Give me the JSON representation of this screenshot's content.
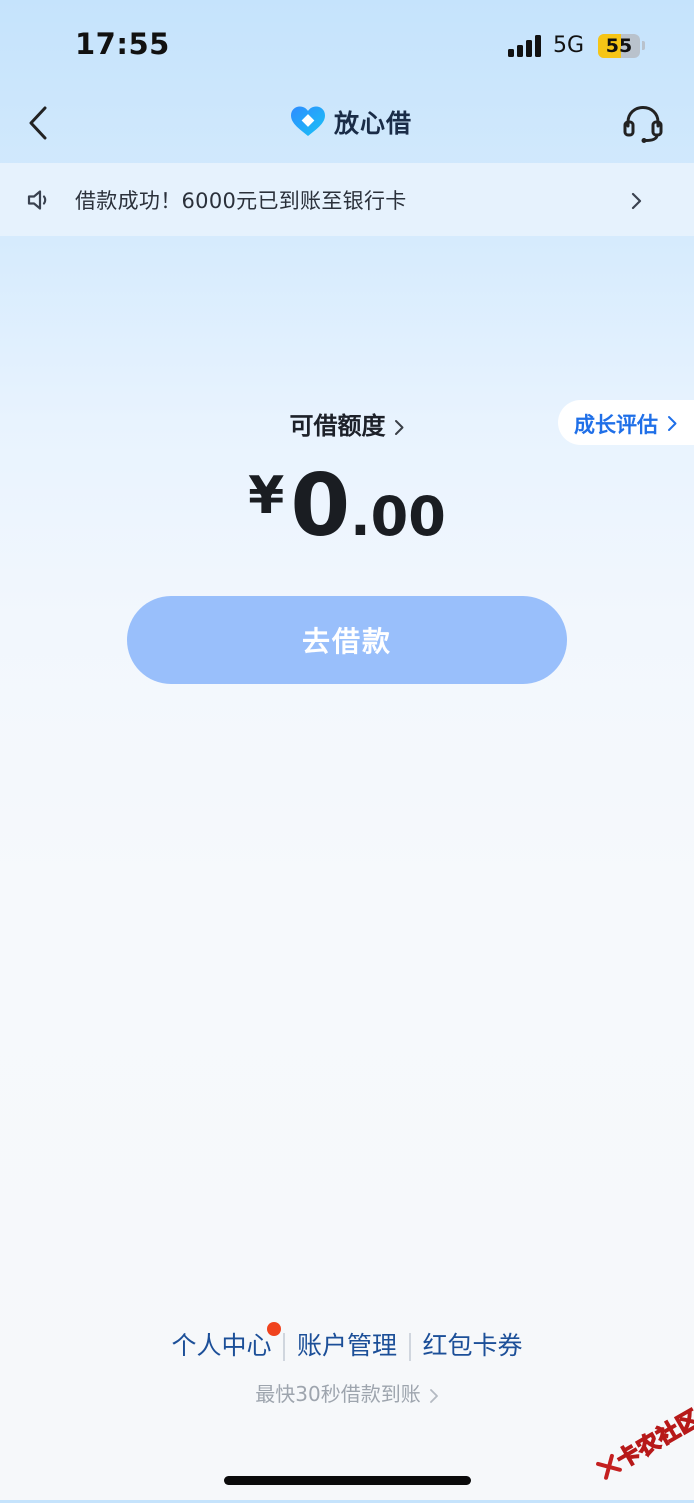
{
  "status_bar": {
    "time": "17:55",
    "network": "5G",
    "battery_level": "55",
    "battery_fraction": 0.55
  },
  "nav": {
    "title": "放心借",
    "back_icon": "chevron-left-icon",
    "support_icon": "headset-icon"
  },
  "notice": {
    "icon": "speaker-icon",
    "text": "借款成功！6000元已到账至银行卡"
  },
  "credit": {
    "label": "可借额度",
    "currency": "¥",
    "amount_int": "0",
    "amount_dec": ".00",
    "growth_label": "成长评估"
  },
  "actions": {
    "borrow_label": "去借款"
  },
  "footer": {
    "links": [
      "个人中心",
      "账户管理",
      "红包卡券"
    ],
    "tagline": "最快30秒借款到账"
  },
  "watermark": {
    "text": "卡农社区"
  },
  "colors": {
    "accent": "#1f6fe8",
    "button": "#99bffb",
    "link": "#1c4f98",
    "badge": "#f0431e",
    "battery": "#f6c516"
  }
}
